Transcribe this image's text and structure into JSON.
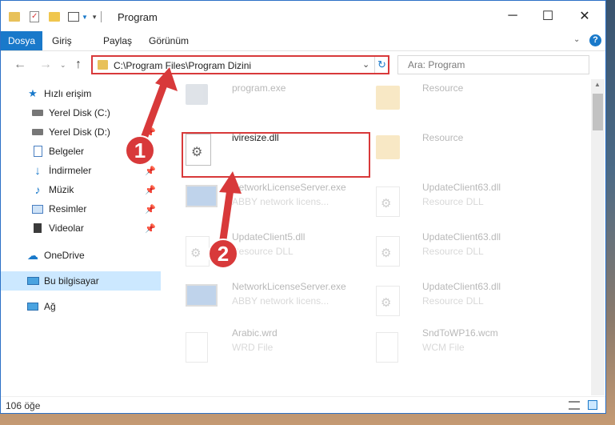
{
  "window": {
    "title": "Program",
    "controls": {
      "minimize": "─",
      "maximize": "☐",
      "close": "✕"
    }
  },
  "ribbon": {
    "tabs": [
      "Dosya",
      "Giriş",
      "Paylaş",
      "Görünüm"
    ],
    "help_glyph": "?"
  },
  "address": {
    "path": "C:\\Program Files\\Program Dizini",
    "search_placeholder": "Ara: Program"
  },
  "nav": {
    "quick_access": "Hızlı erişim",
    "items": [
      "Yerel Disk (C:)",
      "Yerel Disk (D:)",
      "Belgeler",
      "İndirmeler",
      "Müzik",
      "Resimler",
      "Videolar"
    ],
    "onedrive": "OneDrive",
    "this_pc": "Bu bilgisayar",
    "network": "Ağ"
  },
  "files": [
    {
      "name": "program.exe",
      "sub": ""
    },
    {
      "name": "Resource",
      "sub": ""
    },
    {
      "name": "iviresize.dll",
      "sub": ""
    },
    {
      "name": "Resource",
      "sub": ""
    },
    {
      "name": "NetworkLicenseServer.exe",
      "sub": "ABBY network licens..."
    },
    {
      "name": "UpdateClient63.dll",
      "sub": "Resource DLL"
    },
    {
      "name": "UpdateClient5.dll",
      "sub": "Resource DLL"
    },
    {
      "name": "UpdateClient63.dll",
      "sub": "Resource DLL"
    },
    {
      "name": "NetworkLicenseServer.exe",
      "sub": "ABBY network licens..."
    },
    {
      "name": "UpdateClient63.dll",
      "sub": "Resource DLL"
    },
    {
      "name": "Arabic.wrd",
      "sub": "WRD File"
    },
    {
      "name": "SndToWP16.wcm",
      "sub": "WCM File"
    }
  ],
  "status": {
    "count": "106 öğe"
  },
  "callouts": {
    "one": "1",
    "two": "2"
  },
  "colors": {
    "accent": "#1979ca",
    "highlight": "#d8393a",
    "selected": "#cce8ff"
  }
}
